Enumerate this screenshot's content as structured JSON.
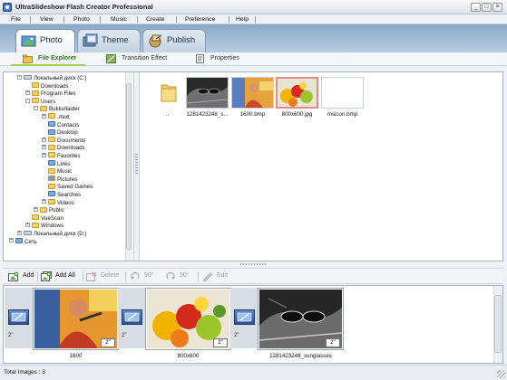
{
  "window": {
    "title": "UltraSlideshow Flash Creator Professional",
    "min_glyph": "_",
    "max_glyph": "□",
    "close_glyph": "×"
  },
  "menu": [
    "File",
    "View",
    "Photo",
    "Music",
    "Create",
    "Preference",
    "Help"
  ],
  "main_tabs": [
    {
      "label": "Photo",
      "icon": "photo-icon",
      "active": true
    },
    {
      "label": "Theme",
      "icon": "theme-icon",
      "active": false
    },
    {
      "label": "Publish",
      "icon": "publish-icon",
      "active": false
    }
  ],
  "sub_tabs": [
    {
      "label": "File Explorer",
      "icon": "file-explorer-icon",
      "active": true
    },
    {
      "label": "Transition Effect",
      "icon": "transition-icon",
      "active": false
    },
    {
      "label": "Properties",
      "icon": "properties-icon",
      "active": false
    }
  ],
  "tree": [
    {
      "label": "Локальный диск (C:)",
      "level": 0,
      "toggle": "-",
      "icon": "drive"
    },
    {
      "label": "Downloads",
      "level": 1,
      "toggle": "",
      "icon": "folder"
    },
    {
      "label": "Program Files",
      "level": 1,
      "toggle": "+",
      "icon": "folder"
    },
    {
      "label": "Users",
      "level": 1,
      "toggle": "-",
      "icon": "folder"
    },
    {
      "label": "Bukkollaider",
      "level": 2,
      "toggle": "-",
      "icon": "folder"
    },
    {
      "label": ".rtext",
      "level": 3,
      "toggle": "+",
      "icon": "folder"
    },
    {
      "label": "Contacts",
      "level": 3,
      "toggle": "",
      "icon": "blue"
    },
    {
      "label": "Desktop",
      "level": 3,
      "toggle": "",
      "icon": "blue"
    },
    {
      "label": "Documents",
      "level": 3,
      "toggle": "+",
      "icon": "folder"
    },
    {
      "label": "Downloads",
      "level": 3,
      "toggle": "+",
      "icon": "folder"
    },
    {
      "label": "Favorites",
      "level": 3,
      "toggle": "+",
      "icon": "folder"
    },
    {
      "label": "Links",
      "level": 3,
      "toggle": "",
      "icon": "blue"
    },
    {
      "label": "Music",
      "level": 3,
      "toggle": "",
      "icon": "folder"
    },
    {
      "label": "Pictures",
      "level": 3,
      "toggle": "",
      "icon": "sel"
    },
    {
      "label": "Saved Games",
      "level": 3,
      "toggle": "",
      "icon": "folder"
    },
    {
      "label": "Searches",
      "level": 3,
      "toggle": "",
      "icon": "blue"
    },
    {
      "label": "Videos",
      "level": 3,
      "toggle": "+",
      "icon": "folder"
    },
    {
      "label": "Public",
      "level": 2,
      "toggle": "+",
      "icon": "folder"
    },
    {
      "label": "VueScan",
      "level": 1,
      "toggle": "",
      "icon": "folder"
    },
    {
      "label": "Windows",
      "level": 1,
      "toggle": "+",
      "icon": "folder"
    },
    {
      "label": "Локальный диск (D:)",
      "level": 0,
      "toggle": "+",
      "icon": "drive"
    },
    {
      "label": "Сеть",
      "level": -1,
      "toggle": "+",
      "icon": "blue"
    }
  ],
  "files": [
    {
      "name": "..",
      "kind": "folder",
      "selected": false
    },
    {
      "name": "1281423248_s...",
      "kind": "sunglasses",
      "selected": false
    },
    {
      "name": "1600.bmp",
      "kind": "dj",
      "selected": false
    },
    {
      "name": "800x600.jpg",
      "kind": "fruit",
      "selected": true
    },
    {
      "name": "msicon.bmp",
      "kind": "blank",
      "selected": false
    }
  ],
  "toolbar": {
    "add": "Add",
    "add_all": "Add All",
    "delete": "Delete",
    "rotate_left": "90°",
    "rotate_right": "90°",
    "edit": "Edit"
  },
  "storyboard": {
    "transitions": [
      "2\"",
      "2\"",
      "2\""
    ],
    "slides": [
      {
        "name": "1600",
        "duration": "2\"",
        "kind": "dj"
      },
      {
        "name": "800x600",
        "duration": "2\"",
        "kind": "fruit"
      },
      {
        "name": "1281423248_sunglasses",
        "duration": "2\"",
        "kind": "sunglasses"
      }
    ]
  },
  "status": {
    "text": "Total Images : 3"
  }
}
